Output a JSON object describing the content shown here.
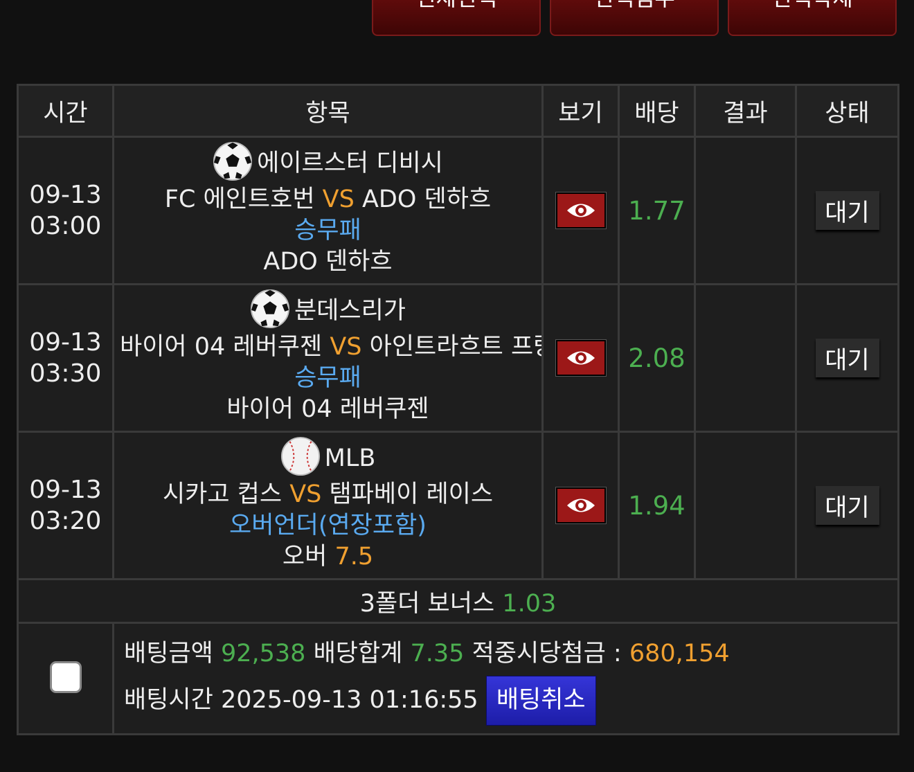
{
  "top_buttons": [
    "전체선택",
    "선택첨부",
    "선택삭제"
  ],
  "headers": {
    "time": "시간",
    "item": "항목",
    "view": "보기",
    "odds": "배당",
    "result": "결과",
    "status": "상태"
  },
  "bets": [
    {
      "date": "09-13",
      "time": "03:00",
      "sport_icon": "soccer-ball-icon",
      "league": "에이르스터 디비시",
      "home": "FC 에인트호번",
      "vs": "VS",
      "away": "ADO 덴하흐",
      "market": "승무패",
      "pick": "ADO 덴하흐",
      "odds": "1.77",
      "result": "",
      "status": "대기"
    },
    {
      "date": "09-13",
      "time": "03:30",
      "sport_icon": "soccer-ball-icon",
      "league": "분데스리가",
      "home": "바이어 04 레버쿠젠",
      "vs": "VS",
      "away": "아인트라흐트 프랑크푸르트",
      "market": "승무패",
      "pick": "바이어 04 레버쿠젠",
      "odds": "2.08",
      "result": "",
      "status": "대기"
    },
    {
      "date": "09-13",
      "time": "03:20",
      "sport_icon": "baseball-icon",
      "league": "MLB",
      "home": "시카고 컵스",
      "vs": "VS",
      "away": "탬파베이 레이스",
      "market": "오버언더(연장포함)",
      "pick": "오버",
      "pick_value": "7.5",
      "odds": "1.94",
      "result": "",
      "status": "대기"
    }
  ],
  "bonus": {
    "label": "3폴더 보너스",
    "value": "1.03"
  },
  "summary": {
    "amount_label": "배팅금액",
    "amount": "92,538",
    "total_odds_label": "배당합계",
    "total_odds": "7.35",
    "payout_label": "적중시당첨금 :",
    "payout": "680,154",
    "time_label": "배팅시간",
    "time": "2025-09-13 01:16:55",
    "cancel_label": "배팅취소"
  },
  "colors": {
    "vs": "#f0a030",
    "market": "#5aaaf0",
    "odds": "#4caf50",
    "eye_button": "#9c1818",
    "cancel_button": "#2a2ac8"
  }
}
